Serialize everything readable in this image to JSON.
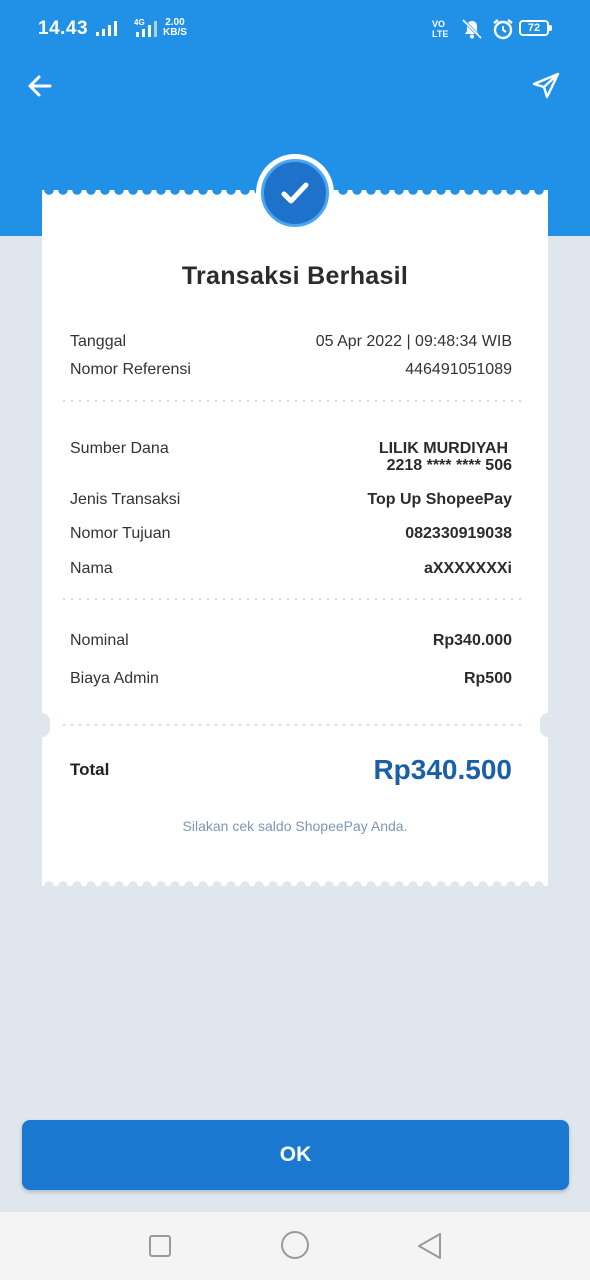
{
  "status_bar": {
    "time": "14.43",
    "network": "4G",
    "speed_value": "2.00",
    "speed_unit": "KB/S",
    "volte_line1": "VO",
    "volte_line2": "LTE",
    "battery": "72"
  },
  "header": {
    "back_icon": "arrow-left-icon",
    "share_icon": "send-icon"
  },
  "receipt": {
    "title": "Transaksi Berhasil",
    "tanggal_label": "Tanggal",
    "tanggal_value": "05 Apr 2022 | 09:48:34 WIB",
    "ref_label": "Nomor Referensi",
    "ref_value": "446491051089",
    "sumber_label": "Sumber Dana",
    "sumber_name": "LILIK MURDIYAH",
    "sumber_account": "2218 **** **** 506",
    "jenis_label": "Jenis Transaksi",
    "jenis_value": "Top Up ShopeePay",
    "tujuan_label": "Nomor Tujuan",
    "tujuan_value": "082330919038",
    "nama_label": "Nama",
    "nama_value": "aXXXXXXXi",
    "nominal_label": "Nominal",
    "nominal_value": "Rp340.000",
    "admin_label": "Biaya Admin",
    "admin_value": "Rp500",
    "total_label": "Total",
    "total_value": "Rp340.500",
    "note": "Silakan cek saldo ShopeePay Anda."
  },
  "ok_button": "OK",
  "colors": {
    "header_blue": "#2191e8",
    "button_blue": "#1b78d0",
    "total_blue": "#1b5fa8",
    "background": "#dfe6ee"
  }
}
